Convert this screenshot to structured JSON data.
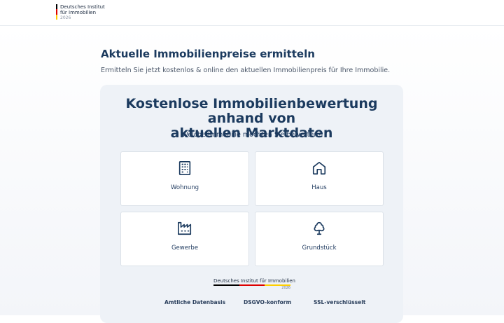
{
  "header": {
    "logo_line1": "Deutsches Institut",
    "logo_line2": "für Immobilien",
    "logo_year": "2026",
    "flag_colors": [
      "#000000",
      "#dd0000",
      "#ffce00"
    ]
  },
  "main": {
    "title": "Aktuelle Immobilienpreise ermitteln",
    "subtitle": "Ermitteln Sie jetzt kostenlos & online den aktuellen Immobilienpreis für Ihre Immobilie."
  },
  "card": {
    "title_line1": "Kostenlose Immobilienbewertung anhand von",
    "title_line2": "aktuellen Marktdaten",
    "question": "Welche Immobilie möchten Sie bewerten?",
    "options": [
      {
        "label": "Wohnung",
        "icon": "apartment-building-icon"
      },
      {
        "label": "Haus",
        "icon": "house-icon"
      },
      {
        "label": "Gewerbe",
        "icon": "factory-icon"
      },
      {
        "label": "Grundstück",
        "icon": "tree-icon"
      }
    ],
    "seal_name": "Deutsches Institut für Immobilien",
    "seal_year": "2026",
    "badges": [
      "Amtliche Datenbasis",
      "DSGVO-konform",
      "SSL-verschlüsselt"
    ]
  },
  "colors": {
    "accent": "#1b3a5e",
    "card_bg": "#eef2f7"
  }
}
